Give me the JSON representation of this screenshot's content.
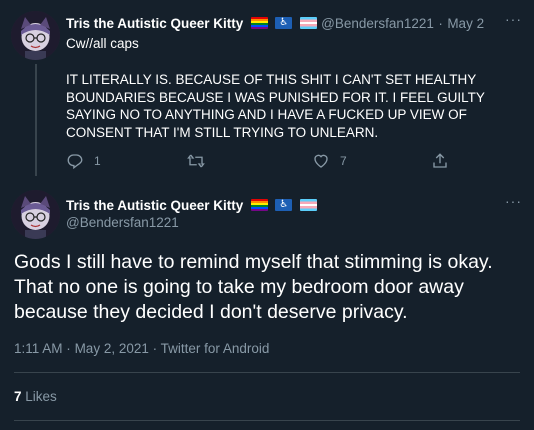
{
  "tweet1": {
    "author_name": "Tris the Autistic Queer Kitty",
    "handle": "@Bendersfan1221",
    "separator": "·",
    "date": "May 2",
    "more": "···",
    "cw": "Cw//all caps",
    "text": "IT LITERALLY IS. BECAUSE OF THIS SHIT I CAN'T SET HEALTHY BOUNDARIES BECAUSE I WAS PUNISHED FOR IT. I FEEL GUILTY SAYING NO TO ANYTHING AND I HAVE A FUCKED UP VIEW OF CONSENT THAT I'M STILL TRYING TO UNLEARN.",
    "reply_count": "1",
    "like_count": "7"
  },
  "tweet2": {
    "author_name": "Tris the Autistic Queer Kitty",
    "handle": "@Bendersfan1221",
    "more": "···",
    "text": "Gods I still have to remind myself that stimming is okay. That no one is going to take my bedroom door away because they decided I don't deserve privacy.",
    "time": "1:11 AM",
    "date": "May 2, 2021",
    "source": "Twitter for Android",
    "meta_sep": "·",
    "likes_count": "7",
    "likes_label": "Likes"
  },
  "colors": {
    "background": "#15202b",
    "secondary_text": "#8899a6",
    "divider": "#38444d"
  },
  "icons": [
    "reply-icon",
    "retweet-icon",
    "like-icon",
    "share-icon",
    "more-icon",
    "rainbow-flag-icon",
    "wheelchair-icon",
    "trans-flag-icon"
  ]
}
